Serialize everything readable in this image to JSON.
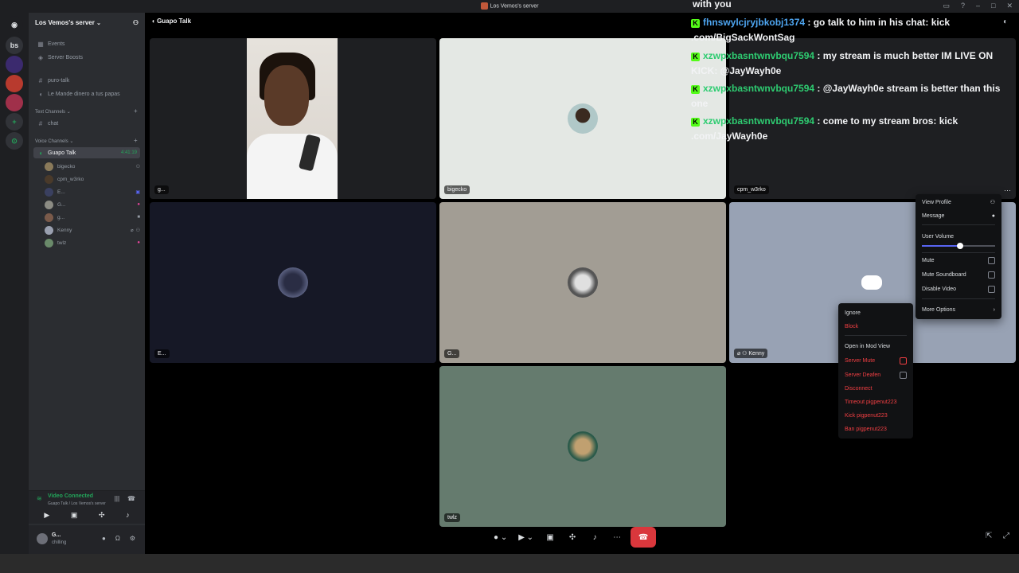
{
  "window": {
    "title": "Los Vemos's server"
  },
  "servers": [
    "bs"
  ],
  "sidebar": {
    "server_name": "Los Vemos's server",
    "events": "Events",
    "boosts": "Server Boosts",
    "ch_puro": "puro-talk",
    "ch_mande": "Le Mande dinero a tus papas",
    "cat_text": "Text Channels",
    "ch_chat": "chat",
    "cat_voice": "Voice Channels",
    "ch_guapo": "Guapo Talk",
    "call_time": "4:41:19",
    "users": [
      "bigecko",
      "cpm_w3rko",
      "E...",
      "G...",
      "g...",
      "Kenny",
      "twlz"
    ]
  },
  "voice_panel": {
    "status": "Video Connected",
    "location": "Guapo Talk / Los Vemos's server"
  },
  "user_panel": {
    "name": "G...",
    "status": "chilling"
  },
  "call": {
    "header": "Guapo Talk",
    "tiles": [
      "g...",
      "bigecko",
      "cpm_w3rko",
      "E...",
      "G...",
      "Kenny",
      "twlz"
    ]
  },
  "chat": {
    "head": "with you",
    "messages": [
      {
        "user": "fhnswylcjryjbkobj1374",
        "text": " : go talk to him in his chat: kick .com/BigSackWontSag"
      },
      {
        "user": "xzwpxbasntwnvbqu7594",
        "text": " : my stream is much better IM LIVE ON KICK: @JayWayh0e"
      },
      {
        "user": "xzwpxbasntwnvbqu7594",
        "text": " : @JayWayh0e stream is better than this one"
      },
      {
        "user": "xzwpxbasntwnvbqu7594",
        "text": " : come to my stream bros: kick .com/JayWayh0e"
      }
    ]
  },
  "menu1": {
    "view_profile": "View Profile",
    "message": "Message",
    "user_volume": "User Volume",
    "volume_level": 0.52,
    "mute": "Mute",
    "mute_soundboard": "Mute Soundboard",
    "disable_video": "Disable Video",
    "more_options": "More Options"
  },
  "menu2": {
    "ignore": "Ignore",
    "block": "Block",
    "mod_view": "Open in Mod View",
    "server_mute": "Server Mute",
    "server_deafen": "Server Deafen",
    "disconnect": "Disconnect",
    "timeout": "Timeout pigpenut223",
    "kick": "Kick pigpenut223",
    "ban": "Ban pigpenut223"
  },
  "colors": {
    "accent": "#5865f2",
    "danger": "#da373c",
    "online": "#23a55a"
  }
}
